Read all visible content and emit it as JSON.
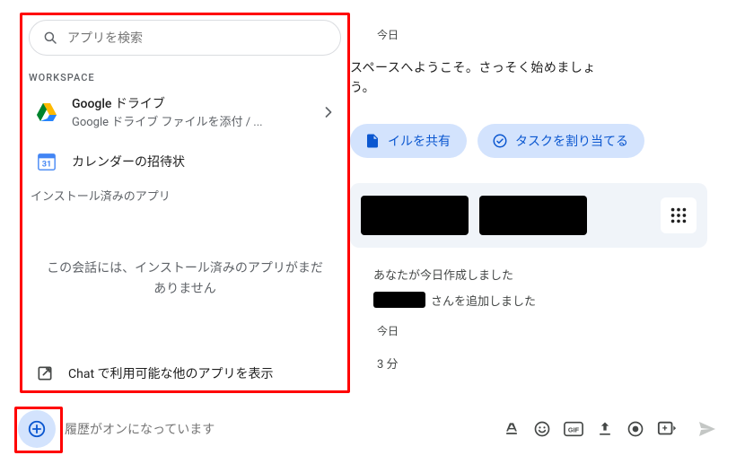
{
  "header": {
    "date": "今日"
  },
  "welcome": {
    "line1": "スペースへようこそ。さっそく始めましょ",
    "line2": "う。"
  },
  "chips": {
    "share_file": "イルを共有",
    "assign_task": "タスクを割り当てる"
  },
  "system_messages": {
    "created": "あなたが今日作成しました",
    "added_suffix": "さんを追加しました"
  },
  "date2": "今日",
  "relative_time": "3 分",
  "compose": {
    "placeholder": "履歴がオンになっています"
  },
  "apps_panel": {
    "search_placeholder": "アプリを検索",
    "section_label": "WORKSPACE",
    "items": [
      {
        "title": "Google ドライブ",
        "sub": "Google ドライブ ファイルを添付 / ..."
      },
      {
        "title": "カレンダーの招待状",
        "sub": ""
      }
    ],
    "installed_label": "インストール済みのアプリ",
    "no_apps": "この会話には、インストール済みのアプリがまだありません",
    "footer": "Chat で利用可能な他のアプリを表示"
  },
  "icons": {
    "search": "search-icon",
    "drive": "drive-icon",
    "calendar": "calendar-icon",
    "chevron_right": "chevron-right-icon",
    "open_external": "open-external-icon",
    "plus": "plus-icon",
    "format": "format-icon",
    "emoji": "emoji-icon",
    "gif": "gif-icon",
    "upload": "upload-icon",
    "record": "record-icon",
    "screen_share": "screen-share-icon",
    "send": "send-icon",
    "task_check": "task-check-icon",
    "share": "share-icon",
    "grid": "grid-icon"
  },
  "colors": {
    "brand_blue": "#0b57d0",
    "chip_bg": "#d3e3fd",
    "muted": "#5f6368",
    "highlight_red": "#ff0000"
  }
}
